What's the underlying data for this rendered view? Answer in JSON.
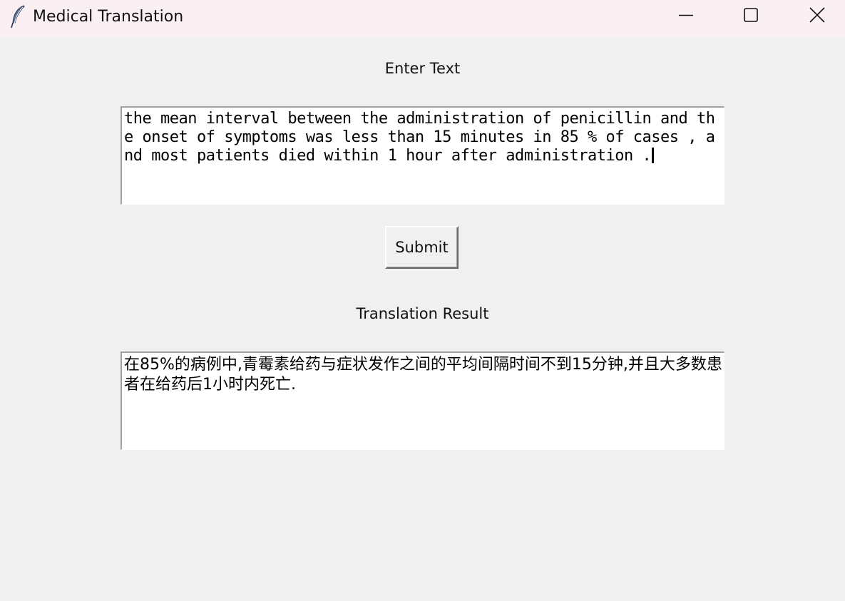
{
  "window": {
    "title": "Medical Translation",
    "icon": "feather-icon",
    "controls": {
      "minimize": "minimize-icon",
      "maximize": "maximize-icon",
      "close": "close-icon"
    }
  },
  "input_section": {
    "label": "Enter Text",
    "value": "the mean interval between the administration of penicillin and the onset of symptoms was less than 15 minutes in 85 % of cases , and most patients died within 1 hour after administration ."
  },
  "submit": {
    "label": "Submit"
  },
  "output_section": {
    "label": "Translation Result",
    "value": "在85%的病例中,青霉素给药与症状发作之间的平均间隔时间不到15分钟,并且大多数患者在给药后1小时内死亡."
  }
}
